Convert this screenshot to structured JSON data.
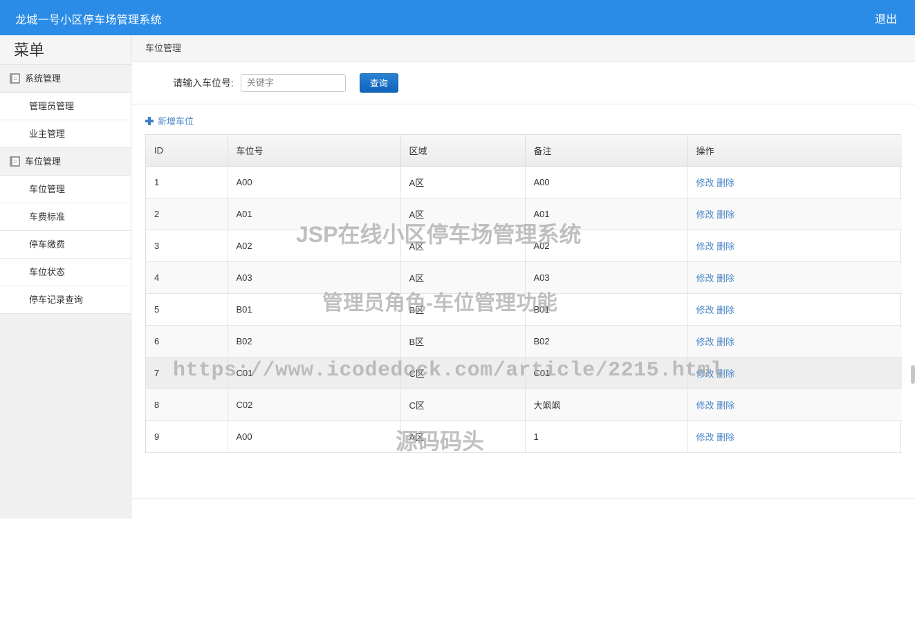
{
  "header": {
    "title": "龙城一号小区停车场管理系统",
    "logout_label": "退出",
    "bg_color": "#2b8ce8"
  },
  "sidebar": {
    "heading": "菜单",
    "groups": [
      {
        "label": "系统管理",
        "icon": "book-icon",
        "items": [
          {
            "label": "管理员管理"
          },
          {
            "label": "业主管理"
          }
        ]
      },
      {
        "label": "车位管理",
        "icon": "book-icon",
        "items": [
          {
            "label": "车位管理"
          },
          {
            "label": "车费标准"
          },
          {
            "label": "停车缴费"
          },
          {
            "label": "车位状态"
          },
          {
            "label": "停车记录查询"
          }
        ]
      }
    ]
  },
  "main": {
    "breadcrumb": "车位管理",
    "search": {
      "label": "请输入车位号:",
      "placeholder": "关键字",
      "value": "",
      "button_label": "查询"
    },
    "add_link_label": "新增车位",
    "table": {
      "columns": [
        "ID",
        "车位号",
        "区域",
        "备注",
        "操作"
      ],
      "actions": {
        "edit": "修改",
        "delete": "删除"
      },
      "rows": [
        {
          "id": "1",
          "no": "A00",
          "area": "A区",
          "note": "A00",
          "hovered": false
        },
        {
          "id": "2",
          "no": "A01",
          "area": "A区",
          "note": "A01",
          "hovered": false
        },
        {
          "id": "3",
          "no": "A02",
          "area": "A区",
          "note": "A02",
          "hovered": false
        },
        {
          "id": "4",
          "no": "A03",
          "area": "A区",
          "note": "A03",
          "hovered": false
        },
        {
          "id": "5",
          "no": "B01",
          "area": "B区",
          "note": "B01",
          "hovered": false
        },
        {
          "id": "6",
          "no": "B02",
          "area": "B区",
          "note": "B02",
          "hovered": false
        },
        {
          "id": "7",
          "no": "C01",
          "area": "C区",
          "note": "C01",
          "hovered": true
        },
        {
          "id": "8",
          "no": "C02",
          "area": "C区",
          "note": "大飒飒",
          "hovered": false
        },
        {
          "id": "9",
          "no": "A00",
          "area": "A区",
          "note": "1",
          "hovered": false
        }
      ]
    }
  },
  "watermarks": {
    "line1": "JSP在线小区停车场管理系统",
    "line2": "管理员角色-车位管理功能",
    "line3": "https://www.icodedock.com/article/2215.html",
    "line4": "源码码头"
  },
  "colors": {
    "accent": "#2b8ce8",
    "link": "#4a86c8",
    "button": "#0f63bb",
    "row_alt": "#f9f9f9",
    "row_hover": "#eeeeee"
  }
}
